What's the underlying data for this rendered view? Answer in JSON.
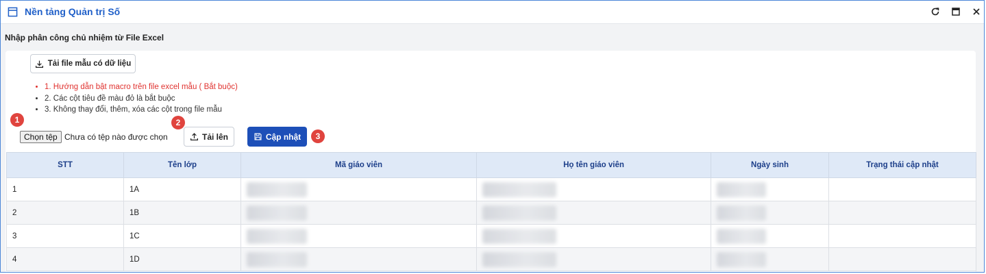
{
  "window": {
    "title": "Nền tảng Quản trị Số"
  },
  "page": {
    "heading": "Nhập phân công chủ nhiệm từ File Excel"
  },
  "toolbar": {
    "download_template_label": "Tải file mẫu có dữ liệu",
    "choose_file_label": "Chọn tệp",
    "no_file_text": "Chưa có tệp nào được chọn",
    "upload_label": "Tải lên",
    "update_label": "Cập nhật"
  },
  "notes": [
    "1. Hướng dẫn bật macro trên file excel mẫu ( Bắt buộc)",
    "2. Các cột tiêu đề màu đỏ là bắt buộc",
    "3. Không thay đổi, thêm, xóa các cột trong file mẫu"
  ],
  "badges": [
    "1",
    "2",
    "3"
  ],
  "table": {
    "columns": [
      "STT",
      "Tên lớp",
      "Mã giáo viên",
      "Họ tên giáo viên",
      "Ngày sinh",
      "Trạng thái cập nhật"
    ],
    "rows": [
      {
        "stt": "1",
        "class": "1A"
      },
      {
        "stt": "2",
        "class": "1B"
      },
      {
        "stt": "3",
        "class": "1C"
      },
      {
        "stt": "4",
        "class": "1D"
      }
    ]
  },
  "colors": {
    "accent": "#1d4fb8",
    "title": "#1f5fc8",
    "badge": "#e0443e",
    "required_note": "#e0322f",
    "header_bg": "#dfe9f7"
  }
}
